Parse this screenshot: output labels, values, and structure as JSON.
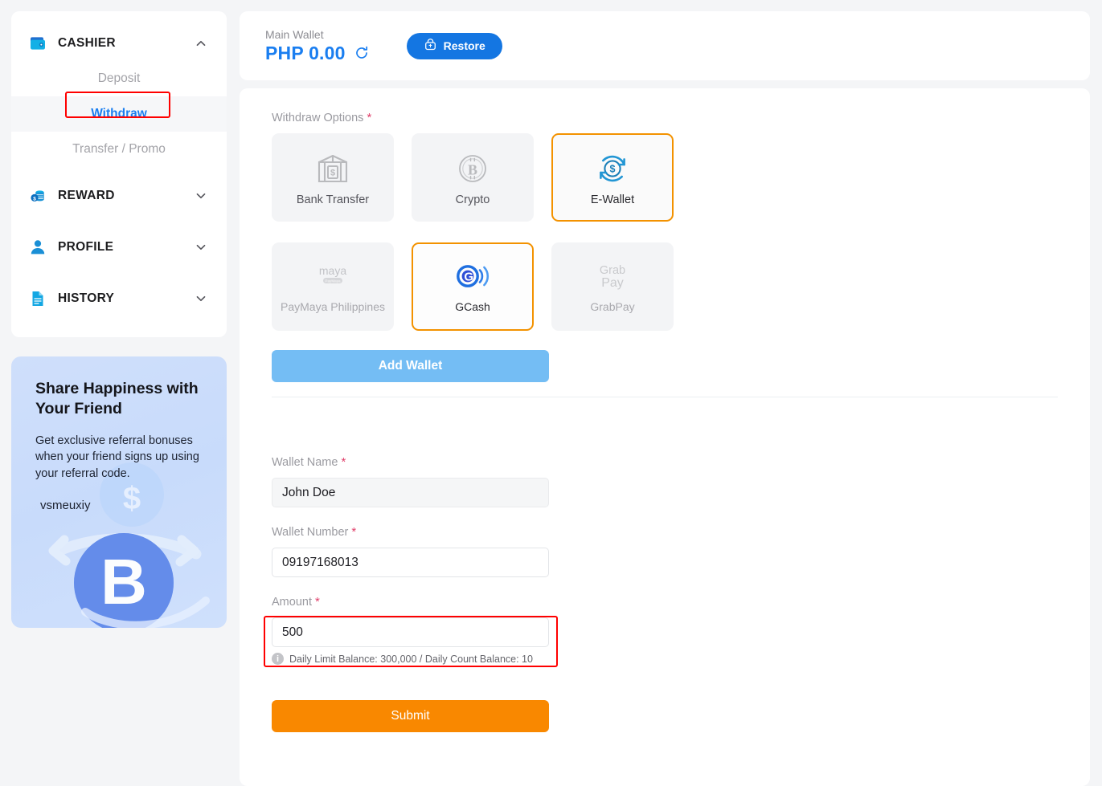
{
  "sidebar": {
    "groups": [
      {
        "id": "cashier",
        "label": "CASHIER",
        "icon": "wallet-icon",
        "expanded": true,
        "chevron": "chevron-up-icon",
        "items": [
          {
            "label": "Deposit",
            "active": false
          },
          {
            "label": "Withdraw",
            "active": true
          },
          {
            "label": "Transfer / Promo",
            "active": false
          }
        ]
      },
      {
        "id": "reward",
        "label": "REWARD",
        "icon": "coins-icon",
        "expanded": false,
        "chevron": "chevron-down-icon",
        "items": []
      },
      {
        "id": "profile",
        "label": "PROFILE",
        "icon": "user-icon",
        "expanded": false,
        "chevron": "chevron-down-icon",
        "items": []
      },
      {
        "id": "history",
        "label": "HISTORY",
        "icon": "document-icon",
        "expanded": false,
        "chevron": "chevron-down-icon",
        "items": []
      }
    ]
  },
  "promo": {
    "title": "Share Happiness with Your Friend",
    "description": "Get exclusive referral bonuses when your friend signs up using your referral code.",
    "referral_code": "vsmeuxiy"
  },
  "wallet": {
    "label": "Main Wallet",
    "amount": "PHP 0.00",
    "refresh_icon": "refresh-icon",
    "restore_label": "Restore",
    "restore_icon": "bag-icon"
  },
  "withdraw": {
    "options_label": "Withdraw Options",
    "required_mark": "*",
    "options": [
      {
        "id": "bank-transfer",
        "label": "Bank Transfer",
        "icon": "bank-icon",
        "selected": false
      },
      {
        "id": "crypto",
        "label": "Crypto",
        "icon": "bitcoin-icon",
        "selected": false
      },
      {
        "id": "e-wallet",
        "label": "E-Wallet",
        "icon": "ewallet-icon",
        "selected": true
      }
    ],
    "providers": [
      {
        "id": "paymaya",
        "label": "PayMaya Philippines",
        "logo": "maya-logo",
        "selected": false
      },
      {
        "id": "gcash",
        "label": "GCash",
        "logo": "gcash-logo",
        "selected": true
      },
      {
        "id": "grabpay",
        "label": "GrabPay",
        "logo": "grabpay-logo",
        "selected": false
      }
    ],
    "add_wallet_label": "Add Wallet",
    "form": {
      "wallet_name_label": "Wallet Name",
      "wallet_name_value": "John Doe",
      "wallet_number_label": "Wallet Number",
      "wallet_number_value": "09197168013",
      "amount_label": "Amount",
      "amount_value": "500",
      "limit_hint": "Daily Limit Balance: 300,000 / Daily Count Balance: 10",
      "info_icon": "info-icon",
      "submit_label": "Submit"
    }
  },
  "colors": {
    "accent_blue": "#1a7ef0",
    "selected_orange": "#f39200",
    "submit_orange": "#f98800",
    "highlight_red": "#ff0000",
    "add_wallet_blue": "#74bdf4"
  }
}
